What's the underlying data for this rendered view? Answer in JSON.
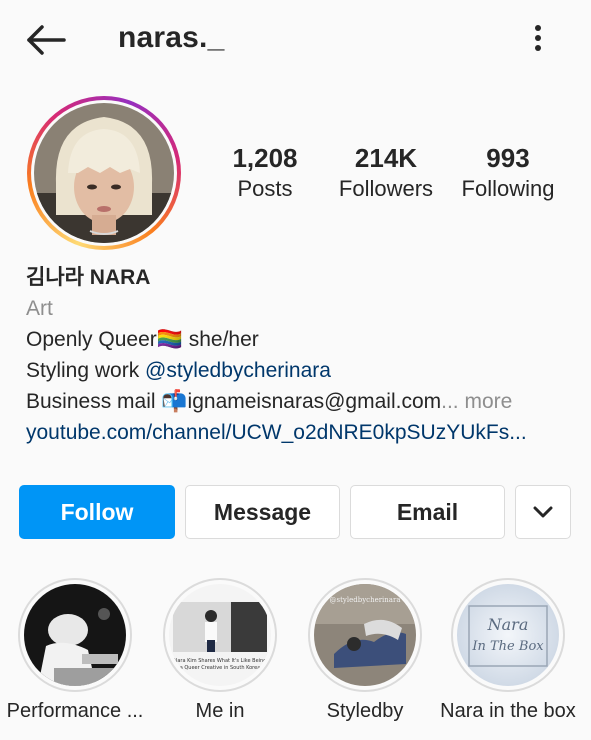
{
  "header": {
    "username": "naras._"
  },
  "stats": {
    "posts": {
      "value": "1,208",
      "label": "Posts"
    },
    "followers": {
      "value": "214K",
      "label": "Followers"
    },
    "following": {
      "value": "993",
      "label": "Following"
    }
  },
  "bio": {
    "display_name": "김나라 NARA",
    "category": "Art",
    "line1_text": "Openly Queer",
    "line1_emoji": "🏳️‍🌈",
    "line1_suffix": " she/her",
    "line2_prefix": "Styling work ",
    "line2_mention": "@styledbycherinara",
    "line3_prefix": "Business mail ",
    "line3_emoji": "📬",
    "line3_text": "ignameisnaras@gmail.com",
    "line3_more": "... more",
    "link": "youtube.com/channel/UCW_o2dNRE0kpSUzYUkFs..."
  },
  "actions": {
    "follow": "Follow",
    "message": "Message",
    "email": "Email"
  },
  "highlights": [
    {
      "label": "Performance ..."
    },
    {
      "label": "Me in"
    },
    {
      "label": "Styledby"
    },
    {
      "label": "Nara in the box"
    }
  ],
  "highlight_art": {
    "me_in_caption": "Nara Kim Shares What It's Like Being a Queer Creative in South Korea",
    "styledby_caption": "@styledbycherinara",
    "box_line1": "Nara",
    "box_line2": "In The Box"
  },
  "colors": {
    "accent_blue": "#0095f6",
    "link_blue": "#00376b",
    "secondary_gray": "#8e8e8e",
    "border_gray": "#dbdbdb"
  },
  "icons": {
    "back": "arrow-left-icon",
    "more": "vertical-ellipsis-icon",
    "dropdown": "chevron-down-icon"
  }
}
